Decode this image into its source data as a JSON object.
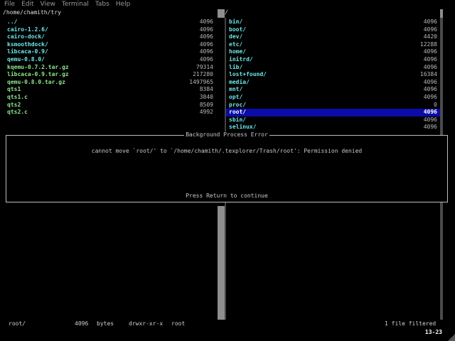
{
  "menu": {
    "items": [
      "File",
      "Edit",
      "View",
      "Terminal",
      "Tabs",
      "Help"
    ]
  },
  "left_pane": {
    "path": "/home/chamith/try",
    "entries": [
      {
        "name": "../",
        "size": "4096",
        "type": "dir"
      },
      {
        "name": "cairo-1.2.6/",
        "size": "4096",
        "type": "dir"
      },
      {
        "name": "cairo-dock/",
        "size": "4096",
        "type": "dir"
      },
      {
        "name": "ksmoothdock/",
        "size": "4096",
        "type": "dir"
      },
      {
        "name": "libcaca-0.9/",
        "size": "4096",
        "type": "dir"
      },
      {
        "name": "qemu-0.8.0/",
        "size": "4096",
        "type": "dir"
      },
      {
        "name": "kqemu-0.7.2.tar.gz",
        "size": "79314",
        "type": "file"
      },
      {
        "name": "libcaca-0.9.tar.gz",
        "size": "217280",
        "type": "file"
      },
      {
        "name": "qemu-0.8.0.tar.gz",
        "size": "1497965",
        "type": "file"
      },
      {
        "name": "qts1",
        "size": "8384",
        "type": "file"
      },
      {
        "name": "qts1.c",
        "size": "3840",
        "type": "file"
      },
      {
        "name": "qts2",
        "size": "8509",
        "type": "file"
      },
      {
        "name": "qts2.c",
        "size": "4992",
        "type": "file"
      }
    ]
  },
  "right_pane": {
    "path": "/",
    "entries": [
      {
        "name": "bin/",
        "size": "4096",
        "type": "dir"
      },
      {
        "name": "boot/",
        "size": "4096",
        "type": "dir"
      },
      {
        "name": "dev/",
        "size": "4420",
        "type": "dir"
      },
      {
        "name": "etc/",
        "size": "12288",
        "type": "dir"
      },
      {
        "name": "home/",
        "size": "4096",
        "type": "dir"
      },
      {
        "name": "initrd/",
        "size": "4096",
        "type": "dir"
      },
      {
        "name": "lib/",
        "size": "4096",
        "type": "dir"
      },
      {
        "name": "lost+found/",
        "size": "16384",
        "type": "dir"
      },
      {
        "name": "media/",
        "size": "4096",
        "type": "dir"
      },
      {
        "name": "mnt/",
        "size": "4096",
        "type": "dir"
      },
      {
        "name": "opt/",
        "size": "4096",
        "type": "dir"
      },
      {
        "name": "proc/",
        "size": "0",
        "type": "dir"
      },
      {
        "name": "root/",
        "size": "4096",
        "type": "dir",
        "selected": true
      },
      {
        "name": "sbin/",
        "size": "4096",
        "type": "dir"
      },
      {
        "name": "selinux/",
        "size": "4096",
        "type": "dir"
      }
    ]
  },
  "dialog": {
    "title": "Background Process Error",
    "message": "cannot move `root/' to `/home/chamith/.texplorer/Trash/root': Permission denied",
    "prompt": "Press Return to continue"
  },
  "status": {
    "name": "root/",
    "size": "4096",
    "unit": "bytes",
    "perms": "drwxr-xr-x",
    "owner": "root",
    "filter": "1 file filtered"
  },
  "cursor_position": "13-23",
  "colors": {
    "dir": "#6de7e7",
    "file": "#8ce88c",
    "selection": "#0b0ba8"
  }
}
